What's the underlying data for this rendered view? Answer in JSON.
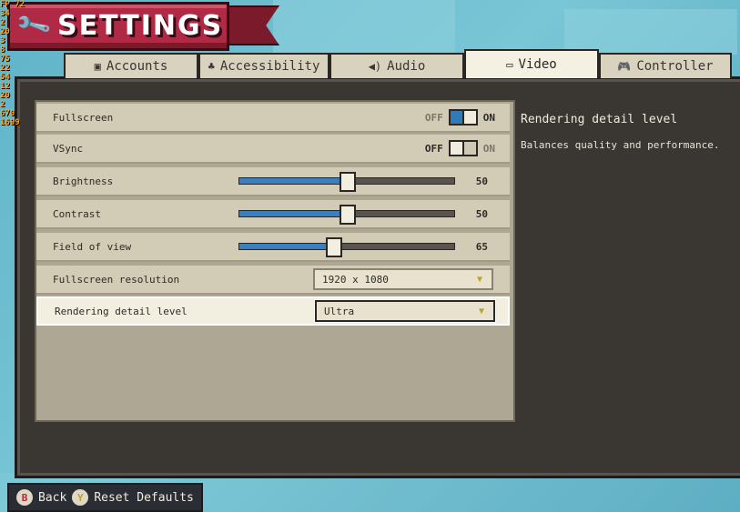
{
  "debug_overlay": [
    "FP 72",
    "34",
    "2",
    "20",
    "3",
    "8",
    "75",
    "22",
    "54",
    "12",
    "20",
    "2",
    "670",
    "1699"
  ],
  "header": {
    "title": "SETTINGS"
  },
  "tabs": [
    {
      "label": "Accounts",
      "icon": "account-icon"
    },
    {
      "label": "Accessibility",
      "icon": "accessibility-icon"
    },
    {
      "label": "Audio",
      "icon": "speaker-icon"
    },
    {
      "label": "Video",
      "icon": "monitor-icon",
      "active": true
    },
    {
      "label": "Controller",
      "icon": "gamepad-icon"
    }
  ],
  "settings": {
    "fullscreen": {
      "label": "Fullscreen",
      "off": "OFF",
      "on": "ON",
      "value": true
    },
    "vsync": {
      "label": "VSync",
      "off": "OFF",
      "on": "ON",
      "value": false
    },
    "brightness": {
      "label": "Brightness",
      "value": 50,
      "display": "50",
      "max": 100
    },
    "contrast": {
      "label": "Contrast",
      "value": 50,
      "display": "50",
      "max": 100
    },
    "fov": {
      "label": "Field of view",
      "value": 65,
      "display": "65",
      "min": 30,
      "max": 110
    },
    "resolution": {
      "label": "Fullscreen resolution",
      "value": "1920 x 1080"
    },
    "detail": {
      "label": "Rendering detail level",
      "value": "Ultra"
    }
  },
  "description": {
    "title": "Rendering detail level",
    "text": "Balances quality and performance."
  },
  "footer": {
    "back_key": "B",
    "back_label": "Back",
    "reset_key": "Y",
    "reset_label": "Reset Defaults"
  },
  "colors": {
    "accent": "#3a7fc0",
    "banner": "#b02a45",
    "frame": "#3a3632"
  }
}
